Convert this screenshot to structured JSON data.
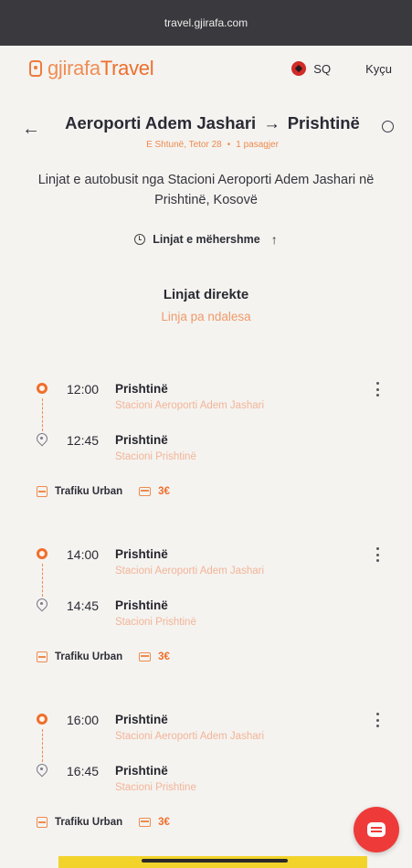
{
  "browser": {
    "url": "travel.gjirafa.com"
  },
  "nav": {
    "logo_prefix": "gjirafa",
    "logo_brand": "Travel",
    "language": "SQ",
    "login": "Kyçu"
  },
  "route": {
    "from": "Aeroporti Adem Jashari",
    "arrow": "→",
    "to": "Prishtinë",
    "date": "E Shtunë, Tetor 28",
    "dot": "•",
    "passengers": "1 pasagjer"
  },
  "description": "Linjat e autobusit nga Stacioni Aeroporti Adem Jashari në Prishtinë, Kosovë",
  "earlier_lines": "Linjat e mëhershme",
  "section": {
    "title": "Linjat direkte",
    "subtitle": "Linja pa ndalesa"
  },
  "trips": [
    {
      "dep_time": "12:00",
      "dep_city": "Prishtinë",
      "dep_station": "Stacioni Aeroporti Adem Jashari",
      "arr_time": "12:45",
      "arr_city": "Prishtinë",
      "arr_station": "Stacioni Prishtinë",
      "operator": "Trafiku Urban",
      "price": "3€"
    },
    {
      "dep_time": "14:00",
      "dep_city": "Prishtinë",
      "dep_station": "Stacioni Aeroporti Adem Jashari",
      "arr_time": "14:45",
      "arr_city": "Prishtinë",
      "arr_station": "Stacioni Prishtinë",
      "operator": "Trafiku Urban",
      "price": "3€"
    },
    {
      "dep_time": "16:00",
      "dep_city": "Prishtinë",
      "dep_station": "Stacioni Aeroporti Adem Jashari",
      "arr_time": "16:45",
      "arr_city": "Prishtinë",
      "arr_station": "Stacioni Prishtine",
      "operator": "Trafiku Urban",
      "price": "3€"
    }
  ],
  "icons": {
    "back": "arrow-left-icon",
    "search": "search-icon",
    "clock": "history-icon",
    "up": "arrow-up-icon",
    "departure": "departure-dot-icon",
    "arrival": "location-pin-icon",
    "bus": "bus-icon",
    "ticket": "ticket-icon",
    "more": "more-vertical-icon",
    "chat": "chat-icon"
  },
  "colors": {
    "accent": "#ef6f2c",
    "chat": "#ee3b3a"
  }
}
